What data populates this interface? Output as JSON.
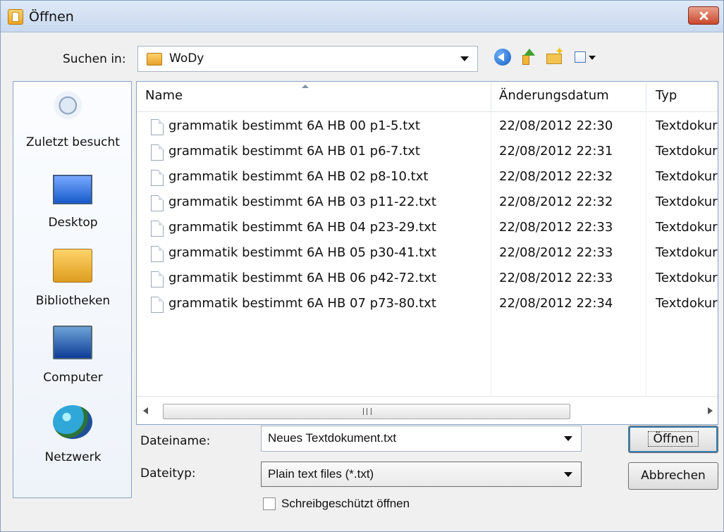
{
  "window": {
    "title": "Öffnen"
  },
  "location": {
    "label": "Suchen in:",
    "value": "WoDy"
  },
  "places": [
    {
      "label": "Zuletzt besucht",
      "icon": "recent-places-icon"
    },
    {
      "label": "Desktop",
      "icon": "desktop-icon"
    },
    {
      "label": "Bibliotheken",
      "icon": "libraries-icon"
    },
    {
      "label": "Computer",
      "icon": "computer-icon"
    },
    {
      "label": "Netzwerk",
      "icon": "network-icon"
    }
  ],
  "columns": {
    "name": "Name",
    "date": "Änderungsdatum",
    "type": "Typ"
  },
  "files": [
    {
      "name": "grammatik bestimmt 6A HB 00 p1-5.txt",
      "date": "22/08/2012 22:30",
      "type": "Textdokur"
    },
    {
      "name": "grammatik bestimmt 6A HB 01 p6-7.txt",
      "date": "22/08/2012 22:31",
      "type": "Textdokur"
    },
    {
      "name": "grammatik bestimmt 6A HB 02 p8-10.txt",
      "date": "22/08/2012 22:32",
      "type": "Textdokur"
    },
    {
      "name": "grammatik bestimmt 6A HB 03 p11-22.txt",
      "date": "22/08/2012 22:32",
      "type": "Textdokur"
    },
    {
      "name": "grammatik bestimmt 6A HB 04 p23-29.txt",
      "date": "22/08/2012 22:33",
      "type": "Textdokur"
    },
    {
      "name": "grammatik bestimmt 6A HB 05 p30-41.txt",
      "date": "22/08/2012 22:33",
      "type": "Textdokur"
    },
    {
      "name": "grammatik bestimmt 6A HB 06 p42-72.txt",
      "date": "22/08/2012 22:33",
      "type": "Textdokur"
    },
    {
      "name": "grammatik bestimmt 6A HB 07 p73-80.txt",
      "date": "22/08/2012 22:34",
      "type": "Textdokur"
    }
  ],
  "filename": {
    "label": "Dateiname:",
    "value": "Neues Textdokument.txt"
  },
  "filetype": {
    "label": "Dateityp:",
    "value": "Plain text files (*.txt)"
  },
  "readonly": {
    "label": "Schreibgeschützt öffnen",
    "checked": false
  },
  "buttons": {
    "open": "Öffnen",
    "cancel": "Abbrechen"
  },
  "scrollbar": {
    "grip": "III"
  }
}
